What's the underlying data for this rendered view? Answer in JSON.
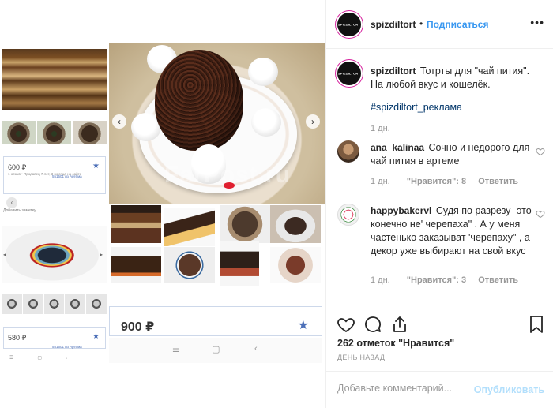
{
  "post_image": {
    "watermark": "FarPost.ru",
    "card_small_1": {
      "price": "600 ₽",
      "meta": "551501 из Артёма",
      "meta2": "1 отзыв • Продавец 7 лет, 3 месяца на сайте"
    },
    "note": "Добавить заметку",
    "card_small_2": {
      "price": "580 ₽",
      "meta": "551501 из Артёма"
    },
    "card_big": {
      "price": "900 ₽"
    },
    "nav": {
      "menu": "☰",
      "home": "▢",
      "back": "‹"
    }
  },
  "header": {
    "username": "spizdiltort",
    "separator": "•",
    "follow_label": "Подписаться",
    "avatar_text": "SPIZDILTORT",
    "more": "•••"
  },
  "caption": {
    "username": "spizdiltort",
    "text": "Тотрты для \"чай пития\". На любой вкус и кошелёк.",
    "hashtag": "#spizdiltort_реклама",
    "time": "1 дн."
  },
  "comments": [
    {
      "username": "ana_kalinaa",
      "text": "Сочно и недорого для чай пития в артеме",
      "time": "1 дн.",
      "likes": "\"Нравится\": 8",
      "reply": "Ответить"
    },
    {
      "username": "happybakervl",
      "text": "Судя по разрезу -это конечно не' черепаха\" . А у меня частенько заказыват 'черепаху\" , а декор уже выбирают на свой вкус",
      "time": "1 дн.",
      "likes": "\"Нравится\": 3",
      "reply": "Ответить"
    }
  ],
  "actions": {
    "likes": "262 отметок \"Нравится\"",
    "posted": "ДЕНЬ НАЗАД"
  },
  "add_comment": {
    "placeholder": "Добавьте комментарий...",
    "publish": "Опубликовать"
  }
}
